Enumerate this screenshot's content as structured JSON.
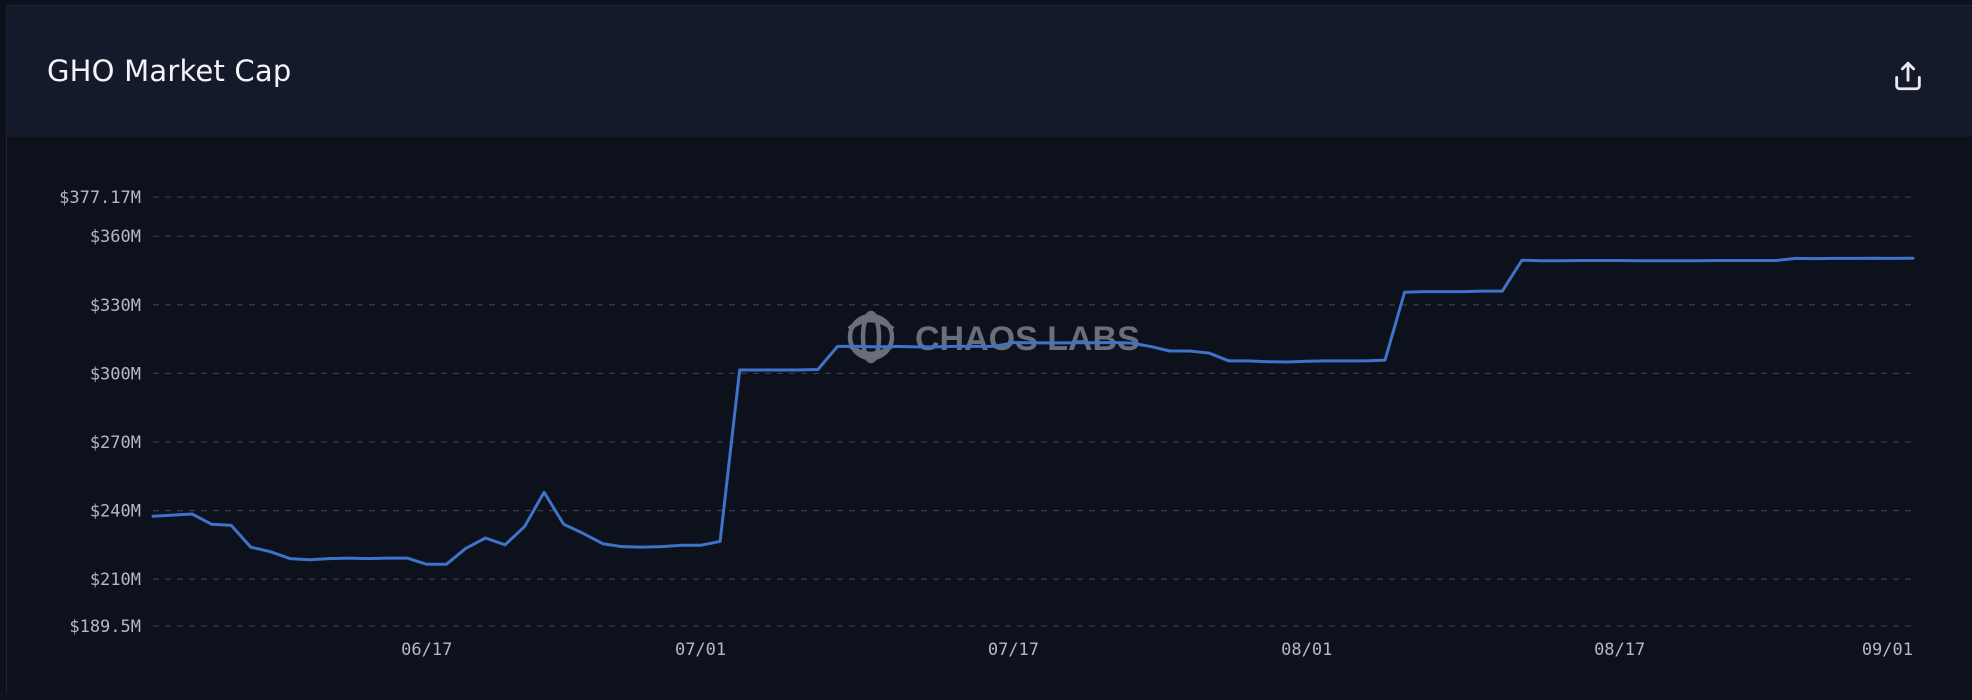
{
  "header": {
    "title": "GHO Market Cap",
    "export_icon": "share-upload-icon"
  },
  "watermark": {
    "text": "CHAOS LABS",
    "icon": "chaos-labs-logo-icon"
  },
  "colors": {
    "line": "#3f72c9",
    "grid": "#343a4a",
    "tick_text": "#b4b9c4",
    "watermark": "#6a6e78",
    "header_bg": "#141a2a",
    "plot_bg": "#0d111c"
  },
  "chart_data": {
    "type": "line",
    "title": "GHO Market Cap",
    "xlabel": "",
    "ylabel": "",
    "ylim": [
      189.5,
      377.17
    ],
    "y_unit": "$M",
    "y_ticks": [
      189.5,
      210,
      240,
      270,
      300,
      330,
      360,
      377.17
    ],
    "y_tick_labels": [
      "$189.5M",
      "$210M",
      "$240M",
      "$270M",
      "$300M",
      "$330M",
      "$360M",
      "$377.17M"
    ],
    "x_ticks": [
      "06/17",
      "07/01",
      "07/17",
      "08/01",
      "08/17",
      "09/01"
    ],
    "x_tick_positions": [
      13,
      27,
      43,
      58,
      74,
      89
    ],
    "xlim": [
      -1,
      89
    ],
    "grid": true,
    "legend": "none",
    "series": [
      {
        "values": [
          [
            -1,
            237.5
          ],
          [
            0,
            238
          ],
          [
            1,
            238.5
          ],
          [
            2,
            234
          ],
          [
            3,
            233.5
          ],
          [
            4,
            224
          ],
          [
            5,
            222
          ],
          [
            6,
            219
          ],
          [
            7,
            218.5
          ],
          [
            8,
            219
          ],
          [
            9,
            219.2
          ],
          [
            10,
            219
          ],
          [
            11,
            219.2
          ],
          [
            12,
            219.2
          ],
          [
            13,
            216.5
          ],
          [
            14,
            216.5
          ],
          [
            15,
            223.5
          ],
          [
            16,
            228
          ],
          [
            17,
            225
          ],
          [
            18,
            233
          ],
          [
            19,
            248
          ],
          [
            20,
            234
          ],
          [
            21,
            230
          ],
          [
            22,
            225.5
          ],
          [
            23,
            224.2
          ],
          [
            24,
            224
          ],
          [
            25,
            224.2
          ],
          [
            26,
            224.8
          ],
          [
            27,
            224.8
          ],
          [
            28,
            226.5
          ],
          [
            29,
            301.5
          ],
          [
            30,
            301.5
          ],
          [
            31,
            301.5
          ],
          [
            32,
            301.5
          ],
          [
            33,
            301.7
          ],
          [
            34,
            311.8
          ],
          [
            35,
            311.8
          ],
          [
            36,
            311.6
          ],
          [
            37,
            311.8
          ],
          [
            38,
            311.6
          ],
          [
            39,
            311.6
          ],
          [
            40,
            311.8
          ],
          [
            41,
            311.8
          ],
          [
            42,
            311.8
          ],
          [
            43,
            313.5
          ],
          [
            44,
            313.4
          ],
          [
            45,
            313.3
          ],
          [
            46,
            313.4
          ],
          [
            47,
            313.4
          ],
          [
            48,
            313.5
          ],
          [
            49,
            313.3
          ],
          [
            50,
            311.8
          ],
          [
            51,
            309.8
          ],
          [
            52,
            309.8
          ],
          [
            53,
            308.9
          ],
          [
            54,
            305.5
          ],
          [
            55,
            305.5
          ],
          [
            56,
            305.1
          ],
          [
            57,
            305
          ],
          [
            58,
            305.3
          ],
          [
            59,
            305.5
          ],
          [
            60,
            305.5
          ],
          [
            61,
            305.5
          ],
          [
            62,
            305.8
          ],
          [
            63,
            335.5
          ],
          [
            64,
            335.8
          ],
          [
            65,
            335.8
          ],
          [
            66,
            335.8
          ],
          [
            67,
            336
          ],
          [
            68,
            336
          ],
          [
            69,
            349.5
          ],
          [
            70,
            349.3
          ],
          [
            71,
            349.3
          ],
          [
            72,
            349.4
          ],
          [
            73,
            349.4
          ],
          [
            74,
            349.4
          ],
          [
            75,
            349.3
          ],
          [
            76,
            349.3
          ],
          [
            77,
            349.3
          ],
          [
            78,
            349.3
          ],
          [
            79,
            349.4
          ],
          [
            80,
            349.4
          ],
          [
            81,
            349.4
          ],
          [
            82,
            349.4
          ],
          [
            83,
            350.3
          ],
          [
            84,
            350.2
          ],
          [
            85,
            350.3
          ],
          [
            86,
            350.3
          ],
          [
            87,
            350.4
          ],
          [
            88,
            350.3
          ],
          [
            89,
            350.4
          ]
        ]
      }
    ]
  }
}
